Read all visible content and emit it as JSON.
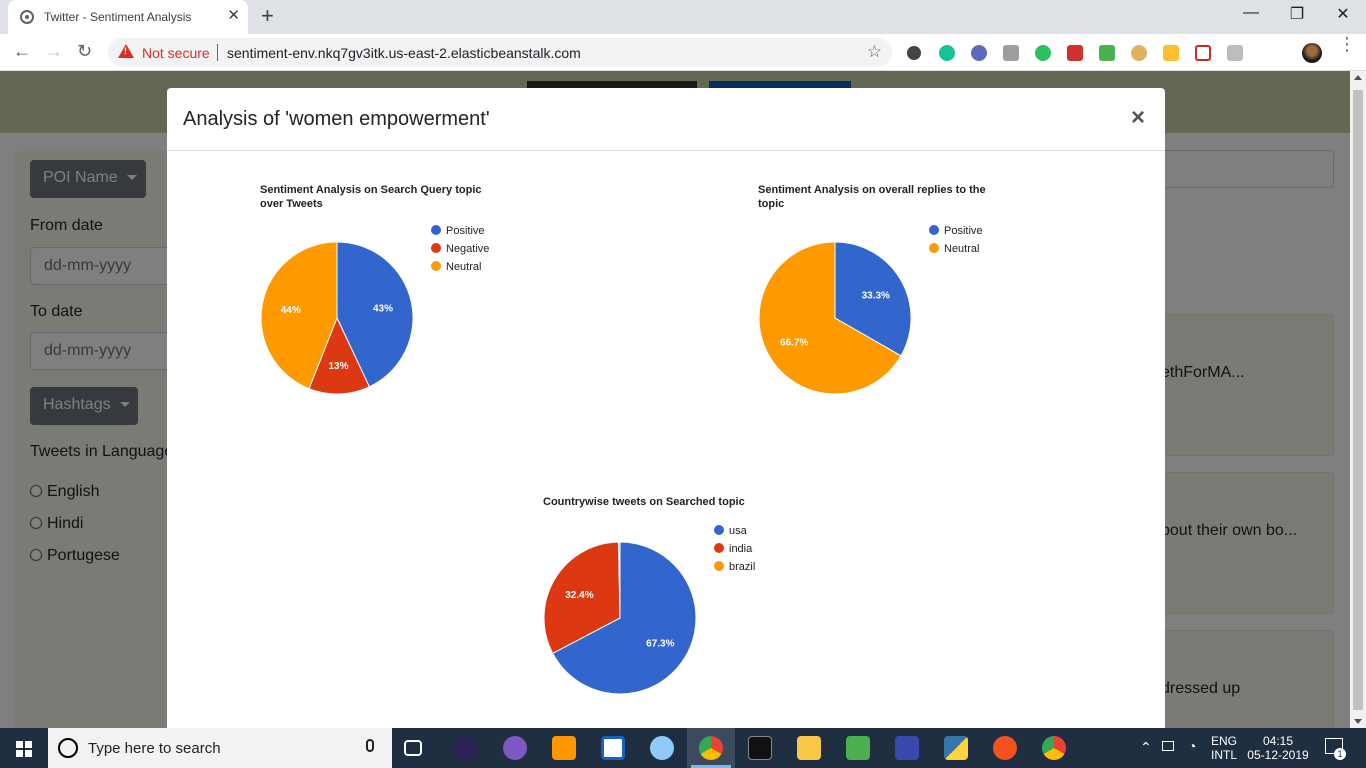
{
  "browser": {
    "tab_title": "Twitter - Sentiment Analysis",
    "tab_close": "✕",
    "new_tab": "+",
    "win_min": "—",
    "win_max": "❐",
    "win_close": "✕",
    "back": "←",
    "forward": "→",
    "reload": "↻",
    "not_secure": "Not secure",
    "url": "sentiment-env.nkq7gv3itk.us-east-2.elasticbeanstalk.com",
    "bookmark": "☆",
    "menu": "⋮"
  },
  "sidebar": {
    "poi_button": "POI Name",
    "from_label": "From date",
    "from_placeholder": "dd-mm-yyyy",
    "to_label": "To date",
    "to_placeholder": "dd-mm-yyyy",
    "hashtags_button": "Hashtags",
    "language_label": "Tweets in Language",
    "languages": [
      "English",
      "Hindi",
      "Portugese"
    ]
  },
  "cards": [
    "ethForMA...",
    "bout their own bo...",
    "dressed up"
  ],
  "modal": {
    "title": "Analysis of 'women empowerment'",
    "close": "×"
  },
  "chart_data": [
    {
      "type": "pie",
      "title": "Sentiment Analysis on Search Query topic over Tweets",
      "labels": [
        "Positive",
        "Negative",
        "Neutral"
      ],
      "values": [
        43,
        13,
        44
      ],
      "slice_labels": [
        "43%",
        "13%",
        "44%"
      ],
      "colors": [
        "#3366cc",
        "#dc3912",
        "#ff9900"
      ],
      "legend": "right"
    },
    {
      "type": "pie",
      "title": "Sentiment Analysis on overall replies to the topic",
      "labels": [
        "Positive",
        "Neutral"
      ],
      "values": [
        33.3,
        66.7
      ],
      "slice_labels": [
        "33.3%",
        "66.7%"
      ],
      "colors": [
        "#3366cc",
        "#ff9900"
      ],
      "legend": "right"
    },
    {
      "type": "pie",
      "title": "Countrywise tweets on Searched topic",
      "labels": [
        "usa",
        "india",
        "brazil"
      ],
      "values": [
        67.3,
        32.4,
        0.3
      ],
      "slice_labels": [
        "67.3%",
        "32.4%",
        ""
      ],
      "colors": [
        "#3366cc",
        "#dc3912",
        "#ff9900"
      ],
      "legend": "right"
    }
  ],
  "taskbar": {
    "search_placeholder": "Type here to search",
    "lang_top": "ENG",
    "lang_bottom": "INTL",
    "time": "04:15",
    "date": "05-12-2019",
    "notification_count": "1"
  }
}
